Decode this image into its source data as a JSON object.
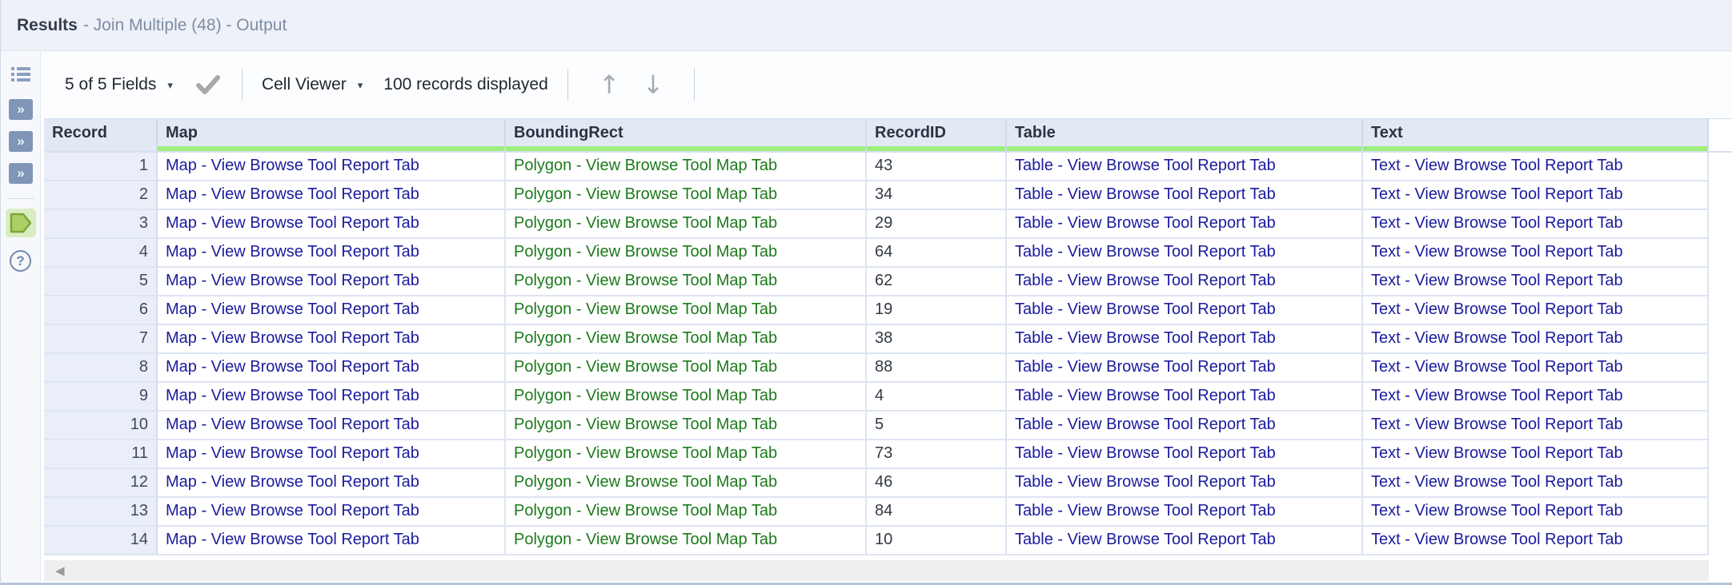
{
  "titlebar": {
    "title": "Results",
    "subtitle": "- Join Multiple (48) - Output"
  },
  "toolbar": {
    "fields_label": "5 of 5 Fields",
    "cell_viewer_label": "Cell Viewer",
    "records_status": "100 records displayed",
    "icons": {
      "caret": "▾",
      "apply_check": "checkmark",
      "up_arrow": "↑",
      "down_arrow": "↓"
    }
  },
  "sidebar": {
    "icons": {
      "metadata_list": "list-lines",
      "input_anchor_glyph": "»",
      "output_anchor": "right-pentagon",
      "help_glyph": "?"
    }
  },
  "table": {
    "columns": [
      {
        "key": "record",
        "label": "Record",
        "quality_bar": false
      },
      {
        "key": "map",
        "label": "Map",
        "quality_bar": true
      },
      {
        "key": "bounding_rect",
        "label": "BoundingRect",
        "quality_bar": true
      },
      {
        "key": "record_id",
        "label": "RecordID",
        "quality_bar": true
      },
      {
        "key": "table",
        "label": "Table",
        "quality_bar": true
      },
      {
        "key": "text",
        "label": "Text",
        "quality_bar": true
      }
    ],
    "rows": [
      {
        "record": 1,
        "map": "Map - View Browse Tool Report Tab",
        "bounding_rect": "Polygon - View Browse Tool Map Tab",
        "record_id": 43,
        "table": "Table - View Browse Tool Report Tab",
        "text": "Text - View Browse Tool Report Tab"
      },
      {
        "record": 2,
        "map": "Map - View Browse Tool Report Tab",
        "bounding_rect": "Polygon - View Browse Tool Map Tab",
        "record_id": 34,
        "table": "Table - View Browse Tool Report Tab",
        "text": "Text - View Browse Tool Report Tab"
      },
      {
        "record": 3,
        "map": "Map - View Browse Tool Report Tab",
        "bounding_rect": "Polygon - View Browse Tool Map Tab",
        "record_id": 29,
        "table": "Table - View Browse Tool Report Tab",
        "text": "Text - View Browse Tool Report Tab"
      },
      {
        "record": 4,
        "map": "Map - View Browse Tool Report Tab",
        "bounding_rect": "Polygon - View Browse Tool Map Tab",
        "record_id": 64,
        "table": "Table - View Browse Tool Report Tab",
        "text": "Text - View Browse Tool Report Tab"
      },
      {
        "record": 5,
        "map": "Map - View Browse Tool Report Tab",
        "bounding_rect": "Polygon - View Browse Tool Map Tab",
        "record_id": 62,
        "table": "Table - View Browse Tool Report Tab",
        "text": "Text - View Browse Tool Report Tab"
      },
      {
        "record": 6,
        "map": "Map - View Browse Tool Report Tab",
        "bounding_rect": "Polygon - View Browse Tool Map Tab",
        "record_id": 19,
        "table": "Table - View Browse Tool Report Tab",
        "text": "Text - View Browse Tool Report Tab"
      },
      {
        "record": 7,
        "map": "Map - View Browse Tool Report Tab",
        "bounding_rect": "Polygon - View Browse Tool Map Tab",
        "record_id": 38,
        "table": "Table - View Browse Tool Report Tab",
        "text": "Text - View Browse Tool Report Tab"
      },
      {
        "record": 8,
        "map": "Map - View Browse Tool Report Tab",
        "bounding_rect": "Polygon - View Browse Tool Map Tab",
        "record_id": 88,
        "table": "Table - View Browse Tool Report Tab",
        "text": "Text - View Browse Tool Report Tab"
      },
      {
        "record": 9,
        "map": "Map - View Browse Tool Report Tab",
        "bounding_rect": "Polygon - View Browse Tool Map Tab",
        "record_id": 4,
        "table": "Table - View Browse Tool Report Tab",
        "text": "Text - View Browse Tool Report Tab"
      },
      {
        "record": 10,
        "map": "Map - View Browse Tool Report Tab",
        "bounding_rect": "Polygon - View Browse Tool Map Tab",
        "record_id": 5,
        "table": "Table - View Browse Tool Report Tab",
        "text": "Text - View Browse Tool Report Tab"
      },
      {
        "record": 11,
        "map": "Map - View Browse Tool Report Tab",
        "bounding_rect": "Polygon - View Browse Tool Map Tab",
        "record_id": 73,
        "table": "Table - View Browse Tool Report Tab",
        "text": "Text - View Browse Tool Report Tab"
      },
      {
        "record": 12,
        "map": "Map - View Browse Tool Report Tab",
        "bounding_rect": "Polygon - View Browse Tool Map Tab",
        "record_id": 46,
        "table": "Table - View Browse Tool Report Tab",
        "text": "Text - View Browse Tool Report Tab"
      },
      {
        "record": 13,
        "map": "Map - View Browse Tool Report Tab",
        "bounding_rect": "Polygon - View Browse Tool Map Tab",
        "record_id": 84,
        "table": "Table - View Browse Tool Report Tab",
        "text": "Text - View Browse Tool Report Tab"
      },
      {
        "record": 14,
        "map": "Map - View Browse Tool Report Tab",
        "bounding_rect": "Polygon - View Browse Tool Map Tab",
        "record_id": 10,
        "table": "Table - View Browse Tool Report Tab",
        "text": "Text - View Browse Tool Report Tab"
      }
    ]
  },
  "scrollbar": {
    "left_arrow": "◀"
  },
  "colors": {
    "quality_bar_green": "#9cee7d",
    "report_link_navy": "#1b1b9e",
    "spatial_green": "#1c7a1c",
    "anchor_blue": "#8096b8",
    "selected_anchor_fill": "#aecf66",
    "selected_anchor_border": "#7da33e",
    "selected_anchor_bg": "#d9edc2",
    "titlebar_bg": "#eef1f8",
    "header_bg": "#e2e9f5",
    "record_col_bg": "#eaeef8"
  }
}
